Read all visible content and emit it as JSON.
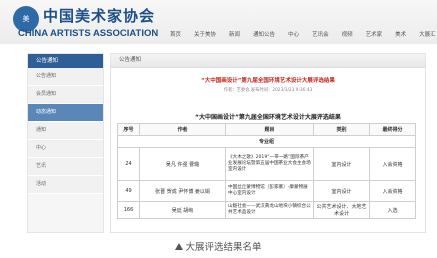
{
  "site": {
    "logo_seal": "美",
    "logo_cn": "中国美术家协会",
    "logo_en": "CHINA ARTISTS ASSOCIATION",
    "nav": [
      "首页",
      "关于美协",
      "新闻",
      "通知公告",
      "中心",
      "艺讯会",
      "视频",
      "艺术家",
      "美术",
      "大展汇"
    ]
  },
  "sidebar": {
    "header": "公告通知",
    "items": [
      "公告通知",
      "会员通知",
      "动态通知",
      "通知",
      "中心",
      "艺讯",
      "活动"
    ],
    "active_index": 2
  },
  "main": {
    "header": "公告通知",
    "article_title": "“大中国画设计”第九届全国环境艺术设计大展评选结果",
    "meta": "作者：艺委会  发布时间：2023/3/23 9:36:43",
    "table_title": "“大中国画设计”第九届全国环境艺术设计大展评选结果",
    "columns": [
      "序号",
      "作者",
      "题目",
      "类别",
      "最终得分"
    ],
    "group_label": "专业组",
    "rows": [
      {
        "no": "24",
        "author": "吴凡 仵强 曹璐",
        "work": "《大木之歌》2019“一带一路”国际茶产业发展论坛暨第五届中国茶业大会主会场室内设计",
        "category": "室内设计",
        "score": "入会资格"
      },
      {
        "no": "49",
        "author": "张晋 贺成 尹怀博 姜以娟",
        "work": "中国丝丘蒙博物馆（彭家寨）-康蒙物展中心室内设计",
        "category": "室内设计",
        "score": "入会资格"
      },
      {
        "no": "166",
        "author": "吴廷 胡峋",
        "work": "山魅社会——武汉黄龙山地块小镇综合公共艺术品设计",
        "category": "公共艺术设计、大地艺术设计",
        "score": "入选"
      }
    ]
  },
  "caption": "大展评选结果名单"
}
